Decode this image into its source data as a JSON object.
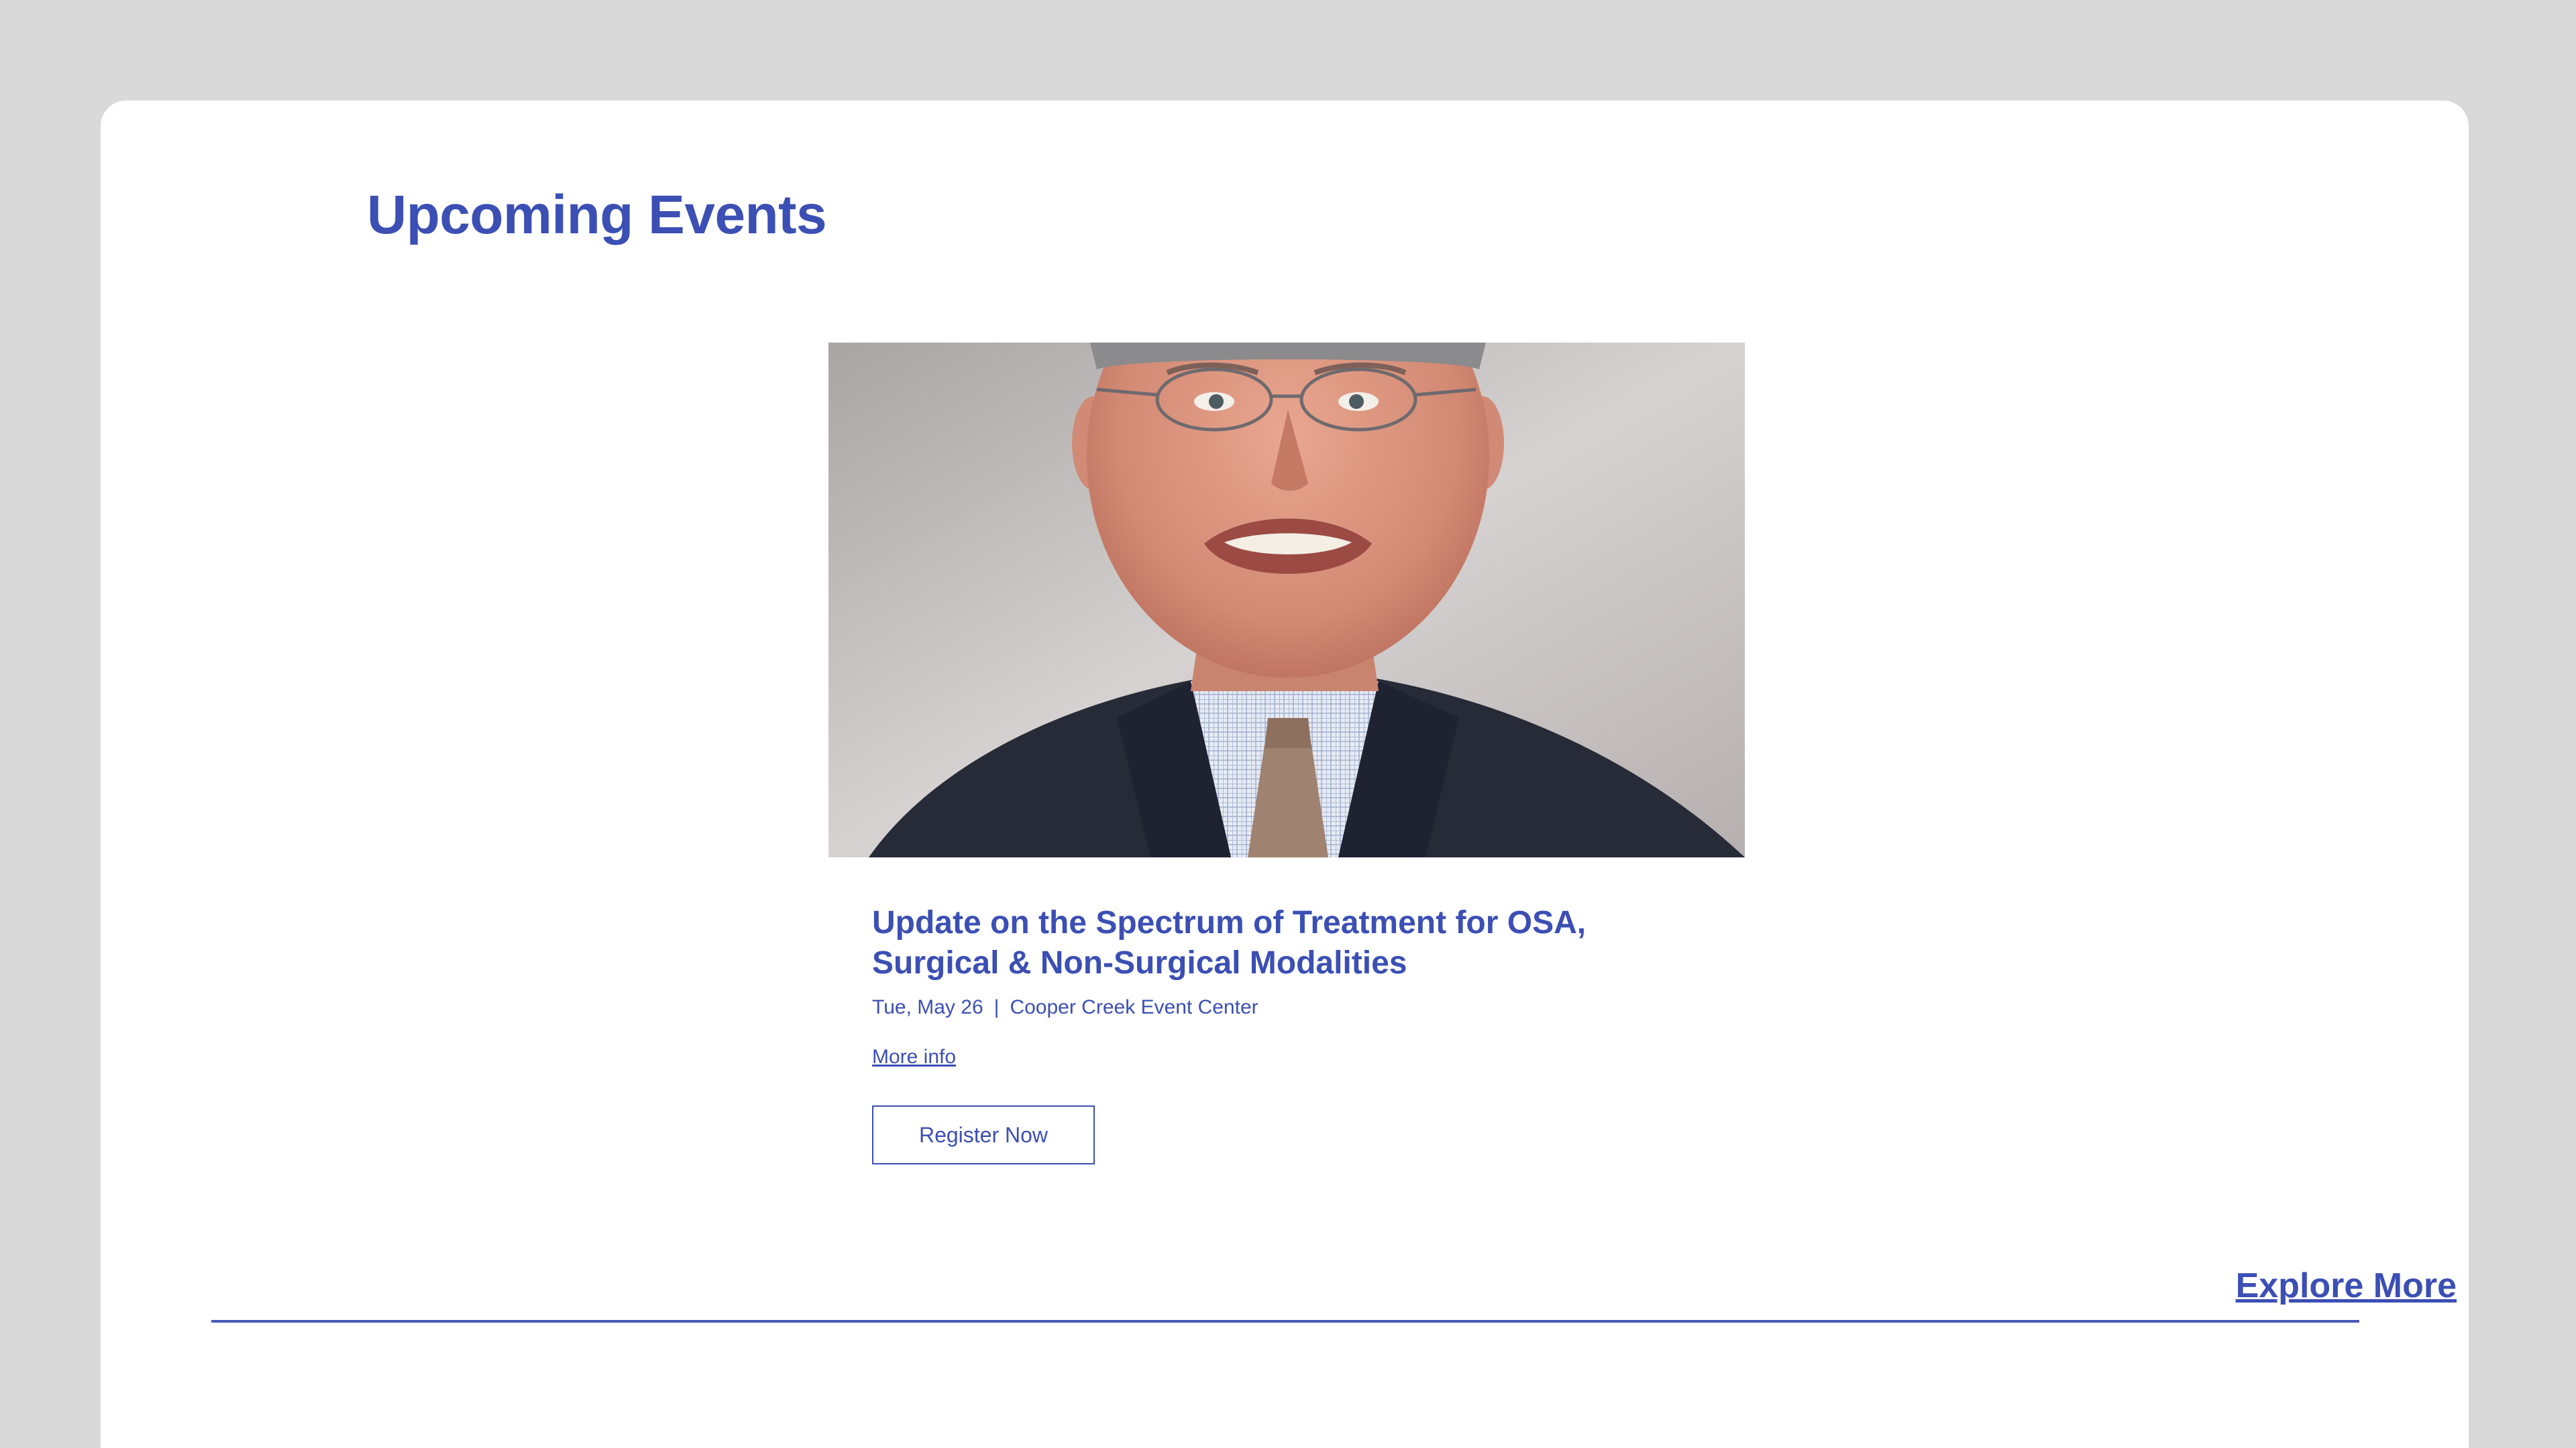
{
  "section": {
    "title": "Upcoming Events"
  },
  "event": {
    "title_line1": "Update on the Spectrum of Treatment for OSA,",
    "title_line2": "Surgical & Non-Surgical Modalities",
    "date": "Tue, May 26",
    "separator": "|",
    "location": "Cooper Creek Event Center",
    "more_info_label": "More info",
    "register_label": "Register Now",
    "photo_description": "headshot-photo"
  },
  "footer": {
    "explore_label": "Explore More"
  },
  "colors": {
    "accent": "#3b4fb4",
    "background": "#d9d9d9",
    "card": "#ffffff"
  }
}
